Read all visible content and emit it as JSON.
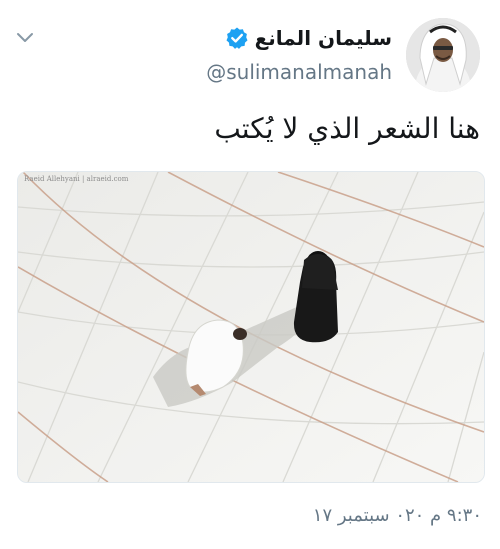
{
  "user": {
    "display_name": "سليمان المانع",
    "handle": "@sulimanalmanah",
    "verified": true
  },
  "tweet": {
    "text": "هنا الشعر الذي لا يُكتب",
    "timestamp": "٩:٣٠ م ٠٢٠ سبتمبر ١٧"
  },
  "media": {
    "watermark": "Raeid Allehyani | alraeid.com"
  },
  "icons": {
    "menu": "chevron-down-icon",
    "verified": "verified-badge-icon"
  },
  "colors": {
    "verified_blue": "#1da1f2",
    "secondary_text": "#657786",
    "primary_text": "#14171a"
  }
}
